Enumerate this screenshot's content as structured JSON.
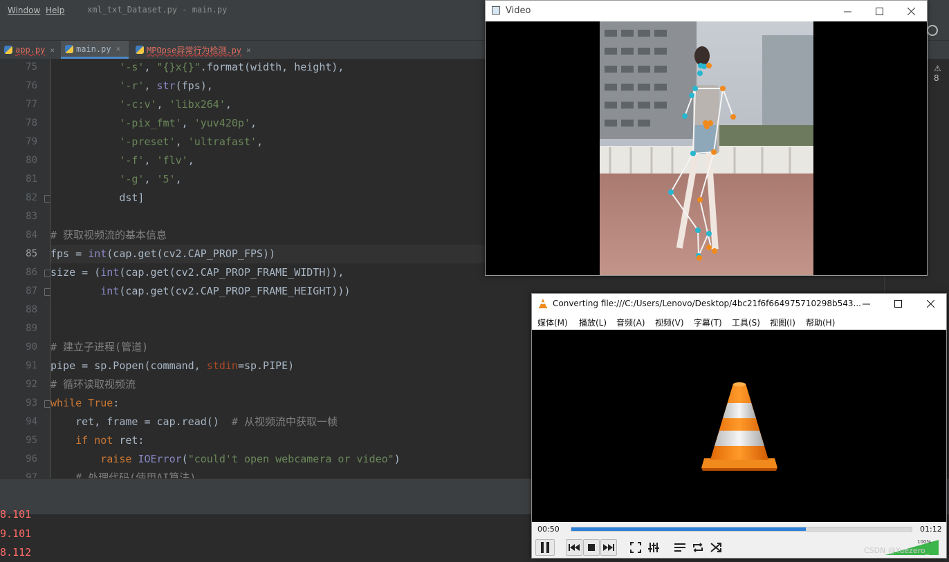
{
  "ide": {
    "menu": [
      "Window",
      "Help"
    ],
    "window_title": "xml_txt_Dataset.py - main.py",
    "tabs": [
      {
        "label": "app.py",
        "state": "error"
      },
      {
        "label": "main.py",
        "state": "active"
      },
      {
        "label": "MPOpse异常行为检测.py",
        "state": "error"
      }
    ],
    "warning_count": "8",
    "current_line": "85",
    "lines": [
      {
        "n": "75",
        "fold": false,
        "seg": [
          [
            "c-df",
            "           "
          ],
          [
            "c-str",
            "'-s'"
          ],
          [
            "c-df",
            ", "
          ],
          [
            "c-str",
            "\"{}x{}\""
          ],
          [
            "c-df",
            ".format(width, height),"
          ]
        ]
      },
      {
        "n": "76",
        "fold": false,
        "seg": [
          [
            "c-df",
            "           "
          ],
          [
            "c-str",
            "'-r'"
          ],
          [
            "c-df",
            ", "
          ],
          [
            "c-bi",
            "str"
          ],
          [
            "c-df",
            "(fps),"
          ]
        ]
      },
      {
        "n": "77",
        "fold": false,
        "seg": [
          [
            "c-df",
            "           "
          ],
          [
            "c-str",
            "'-c:v'"
          ],
          [
            "c-df",
            ", "
          ],
          [
            "c-str",
            "'libx264'"
          ],
          [
            "c-df",
            ","
          ]
        ]
      },
      {
        "n": "78",
        "fold": false,
        "seg": [
          [
            "c-df",
            "           "
          ],
          [
            "c-str",
            "'-pix_fmt'"
          ],
          [
            "c-df",
            ", "
          ],
          [
            "c-str",
            "'yuv420p'"
          ],
          [
            "c-df",
            ","
          ]
        ]
      },
      {
        "n": "79",
        "fold": false,
        "seg": [
          [
            "c-df",
            "           "
          ],
          [
            "c-str",
            "'-preset'"
          ],
          [
            "c-df",
            ", "
          ],
          [
            "c-str",
            "'ultrafast'"
          ],
          [
            "c-df",
            ","
          ]
        ]
      },
      {
        "n": "80",
        "fold": false,
        "seg": [
          [
            "c-df",
            "           "
          ],
          [
            "c-str",
            "'-f'"
          ],
          [
            "c-df",
            ", "
          ],
          [
            "c-str",
            "'flv'"
          ],
          [
            "c-df",
            ","
          ]
        ]
      },
      {
        "n": "81",
        "fold": false,
        "seg": [
          [
            "c-df",
            "           "
          ],
          [
            "c-str",
            "'-g'"
          ],
          [
            "c-df",
            ", "
          ],
          [
            "c-str",
            "'5'"
          ],
          [
            "c-df",
            ","
          ]
        ]
      },
      {
        "n": "82",
        "fold": true,
        "seg": [
          [
            "c-df",
            "           dst]"
          ]
        ]
      },
      {
        "n": "83",
        "fold": false,
        "seg": [
          [
            "c-df",
            ""
          ]
        ]
      },
      {
        "n": "84",
        "fold": false,
        "seg": [
          [
            "c-cm",
            "# 获取视频流的基本信息"
          ]
        ]
      },
      {
        "n": "85",
        "fold": false,
        "seg": [
          [
            "c-df",
            "fps = "
          ],
          [
            "c-bi",
            "int"
          ],
          [
            "c-df",
            "(cap.get(cv2.CAP_PROP_FPS))"
          ]
        ]
      },
      {
        "n": "86",
        "fold": true,
        "seg": [
          [
            "c-df",
            "size = ("
          ],
          [
            "c-bi",
            "int"
          ],
          [
            "c-df",
            "(cap.get(cv2.CAP_PROP_FRAME_WIDTH)),"
          ]
        ]
      },
      {
        "n": "87",
        "fold": true,
        "seg": [
          [
            "c-df",
            "        "
          ],
          [
            "c-bi",
            "int"
          ],
          [
            "c-df",
            "(cap.get(cv2.CAP_PROP_FRAME_HEIGHT)))"
          ]
        ]
      },
      {
        "n": "88",
        "fold": false,
        "seg": [
          [
            "c-df",
            ""
          ]
        ]
      },
      {
        "n": "89",
        "fold": false,
        "seg": [
          [
            "c-df",
            ""
          ]
        ]
      },
      {
        "n": "90",
        "fold": false,
        "seg": [
          [
            "c-cm",
            "# 建立子进程(管道)"
          ]
        ]
      },
      {
        "n": "91",
        "fold": false,
        "seg": [
          [
            "c-df",
            "pipe = sp.Popen(command, "
          ],
          [
            "c-pm",
            "stdin"
          ],
          [
            "c-df",
            "=sp.PIPE)"
          ]
        ]
      },
      {
        "n": "92",
        "fold": false,
        "seg": [
          [
            "c-cm",
            "# 循环读取视频流"
          ]
        ]
      },
      {
        "n": "93",
        "fold": true,
        "seg": [
          [
            "c-kw",
            "while True"
          ],
          [
            "c-df",
            ":"
          ]
        ]
      },
      {
        "n": "94",
        "fold": false,
        "seg": [
          [
            "c-df",
            "    ret, frame = cap.read()  "
          ],
          [
            "c-cm",
            "# 从视频流中获取一帧"
          ]
        ]
      },
      {
        "n": "95",
        "fold": false,
        "seg": [
          [
            "c-df",
            "    "
          ],
          [
            "c-kw",
            "if not "
          ],
          [
            "c-df",
            "ret:"
          ]
        ]
      },
      {
        "n": "96",
        "fold": false,
        "seg": [
          [
            "c-df",
            "        "
          ],
          [
            "c-kw",
            "raise "
          ],
          [
            "c-bi",
            "IOError"
          ],
          [
            "c-df",
            "("
          ],
          [
            "c-str",
            "\"could't open webcamera or video\""
          ],
          [
            "c-df",
            ")"
          ]
        ]
      },
      {
        "n": "97",
        "fold": false,
        "seg": [
          [
            "c-df",
            "    "
          ],
          [
            "c-cm",
            "# 处理代码(使用AI算法)"
          ]
        ]
      }
    ],
    "console_lines": [
      "8.101",
      "9.101",
      "8.112"
    ]
  },
  "video_window": {
    "title": "Video",
    "buttons": [
      "minimize",
      "maximize",
      "close"
    ]
  },
  "vlc": {
    "title": "Converting file:///C:/Users/Lenovo/Desktop/4bc21f6f664975710298b543...",
    "menu": [
      "媒体(M)",
      "播放(L)",
      "音频(A)",
      "视频(V)",
      "字幕(T)",
      "工具(S)",
      "视图(I)",
      "帮助(H)"
    ],
    "elapsed": "00:50",
    "total": "01:12",
    "progress": 0.69,
    "volume_label": "100%",
    "accent_color": "#2f80d8"
  },
  "watermark": "CSDN @Yuezero_"
}
